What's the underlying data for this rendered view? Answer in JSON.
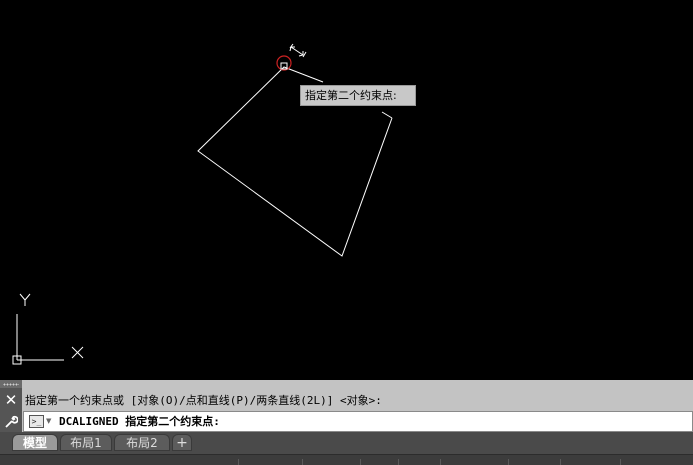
{
  "tooltip": {
    "text": "指定第二个约束点:"
  },
  "ucs": {
    "y_label": "Y",
    "x_label": "X"
  },
  "command": {
    "history": "指定第一个约束点或 [对象(O)/点和直线(P)/两条直线(2L)] <对象>:",
    "prompt_icon": ">_",
    "current": "DCALIGNED 指定第二个约束点:",
    "close_glyph": "✕",
    "custom_glyph": "🔧"
  },
  "tabs": [
    {
      "label": "模型",
      "active": true
    },
    {
      "label": "布局1",
      "active": false
    },
    {
      "label": "布局2",
      "active": false
    }
  ],
  "tab_add": "+",
  "colors": {
    "canvas_bg": "#000000",
    "geometry": "#ffffff",
    "marker": "#cc2222"
  }
}
